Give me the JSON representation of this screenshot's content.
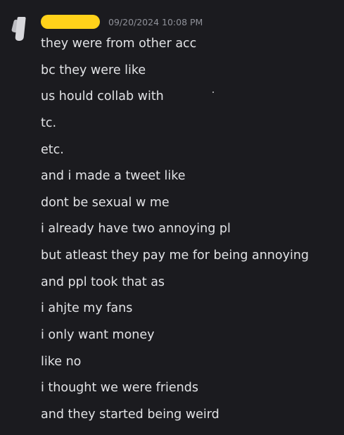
{
  "message": {
    "timestamp": "09/20/2024 10:08 PM",
    "username_redacted_color": "#ffd21a",
    "lines": [
      "they were from other acc",
      "bc they were like",
      "us hould collab with",
      "tc.",
      "etc.",
      "and i made a tweet like",
      "dont be sexual w me",
      "i already have two annoying pl",
      "but atleast they pay me for being annoying",
      "and ppl took that as",
      "i ahjte my fans",
      "i only want money",
      "like no",
      "i thought we were friends",
      "and they started being weird"
    ]
  },
  "colors": {
    "background": "#1b1b1f",
    "text": "#e2e3e6",
    "timestamp": "#8f9199"
  },
  "icons": {
    "avatar": "user-avatar-icon"
  }
}
